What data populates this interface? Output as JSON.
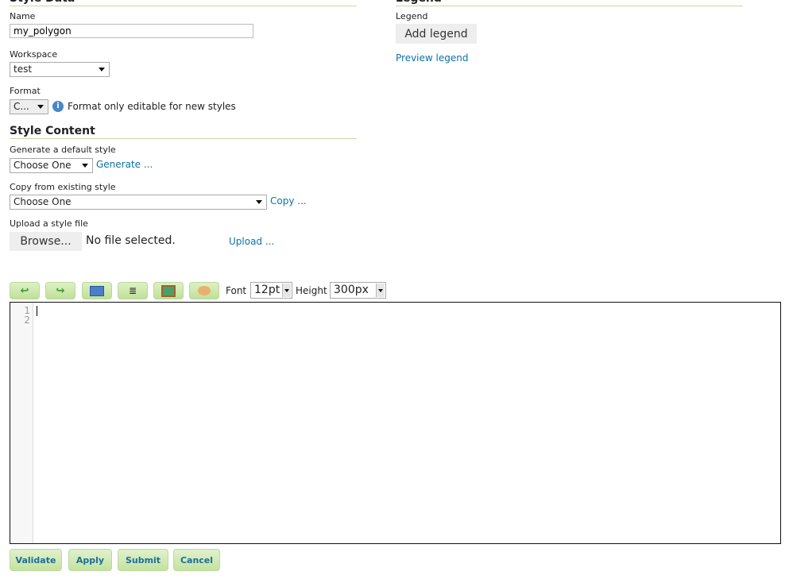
{
  "style_data": {
    "heading": "Style Data",
    "name_label": "Name",
    "name_value": "my_polygon",
    "workspace_label": "Workspace",
    "workspace_value": "test",
    "format_label": "Format",
    "format_value": "C...",
    "format_note": "Format only editable for new styles"
  },
  "legend": {
    "heading": "Legend",
    "label": "Legend",
    "add_button": "Add legend",
    "preview_link": "Preview legend"
  },
  "style_content": {
    "heading": "Style Content",
    "generate_label": "Generate a default style",
    "generate_value": "Choose One",
    "generate_link": "Generate ...",
    "copy_label": "Copy from existing style",
    "copy_value": "Choose One",
    "copy_link": "Copy ...",
    "upload_label": "Upload a style file",
    "browse_button": "Browse...",
    "no_file": "No file selected.",
    "upload_link": "Upload ..."
  },
  "toolbar": {
    "font_label": "Font",
    "font_value": "12pt",
    "height_label": "Height",
    "height_value": "300px",
    "icons": [
      "undo-icon",
      "redo-icon",
      "goto-line-icon",
      "reformat-icon",
      "image-icon",
      "palette-icon"
    ]
  },
  "editor": {
    "line_numbers": [
      "1",
      "2"
    ]
  },
  "actions": {
    "validate": "Validate",
    "apply": "Apply",
    "submit": "Submit",
    "cancel": "Cancel"
  }
}
